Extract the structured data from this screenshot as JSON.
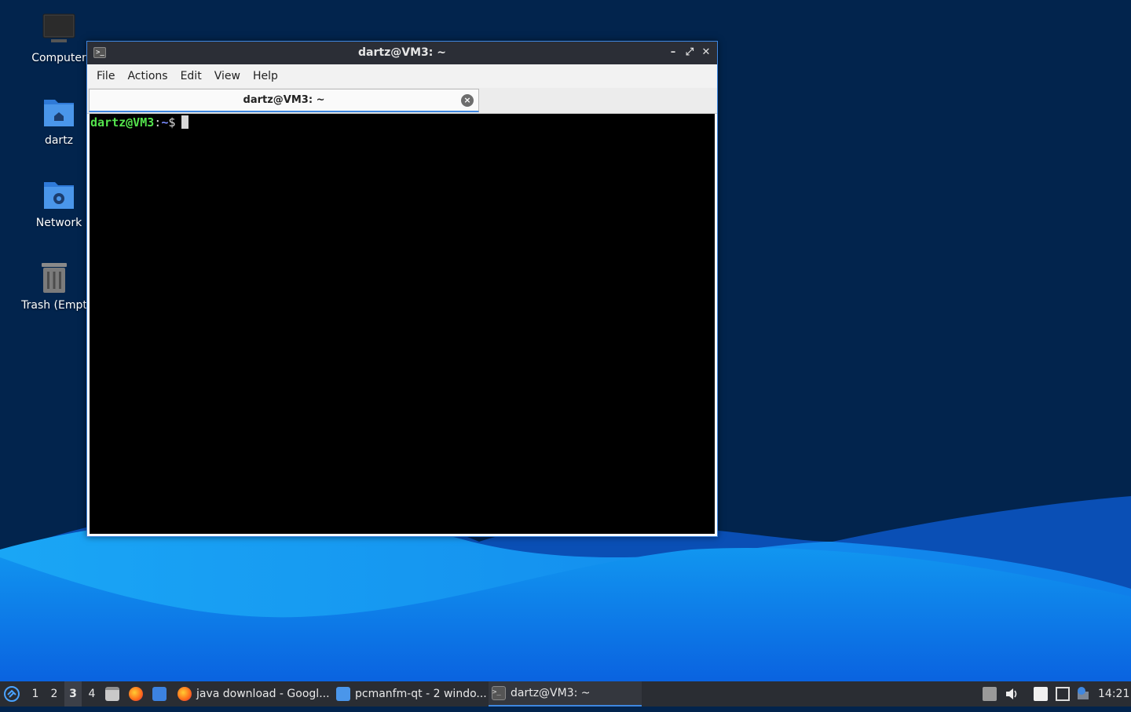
{
  "colors": {
    "desktop_bg": "#02244d",
    "accent": "#3f87e0",
    "terminal_bg": "#000000",
    "prompt_user": "#54e34d",
    "prompt_path": "#7a8cff"
  },
  "desktop": {
    "icons": [
      {
        "label": "Computer",
        "icon": "computer-icon"
      },
      {
        "label": "dartz",
        "icon": "home-folder-icon"
      },
      {
        "label": "Network",
        "icon": "network-folder-icon"
      },
      {
        "label": "Trash (Empt",
        "icon": "trash-icon"
      }
    ]
  },
  "window": {
    "title": "dartz@VM3: ~",
    "menu": [
      "File",
      "Actions",
      "Edit",
      "View",
      "Help"
    ],
    "tab_label": "dartz@VM3: ~",
    "prompt_user": "dartz@VM3",
    "prompt_sep": ":",
    "prompt_path": "~",
    "prompt_symbol": "$"
  },
  "taskbar": {
    "workspaces": [
      "1",
      "2",
      "3",
      "4"
    ],
    "active_workspace": "3",
    "tasks": [
      {
        "label": "java download - Googl...",
        "icon": "firefox-icon"
      },
      {
        "label": "pcmanfm-qt - 2 windo...",
        "icon": "folder-icon"
      },
      {
        "label": "dartz@VM3: ~",
        "icon": "terminal-icon"
      }
    ],
    "clock": "14:21"
  }
}
